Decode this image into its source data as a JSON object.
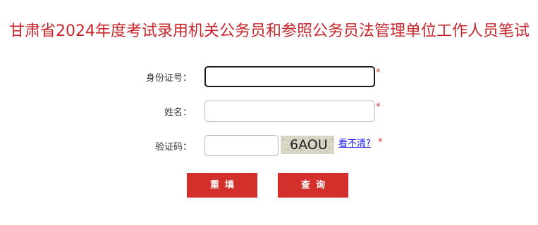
{
  "title": "甘肃省2024年度考试录用机关公务员和参照公务员法管理单位工作人员笔试",
  "form": {
    "id_label": "身份证号：",
    "id_value": "",
    "name_label": "姓名：",
    "name_value": "",
    "captcha_label": "验证码：",
    "captcha_value": "",
    "required_mark": "*",
    "captcha_image_text": "6AOU",
    "captcha_refresh_text": "看不清?"
  },
  "buttons": {
    "reset_label": "重填",
    "query_label": "查询"
  },
  "colors": {
    "title": "#c8262b",
    "button_bg": "#d3302c",
    "required": "#e03a3a",
    "link": "#1a1aee"
  }
}
